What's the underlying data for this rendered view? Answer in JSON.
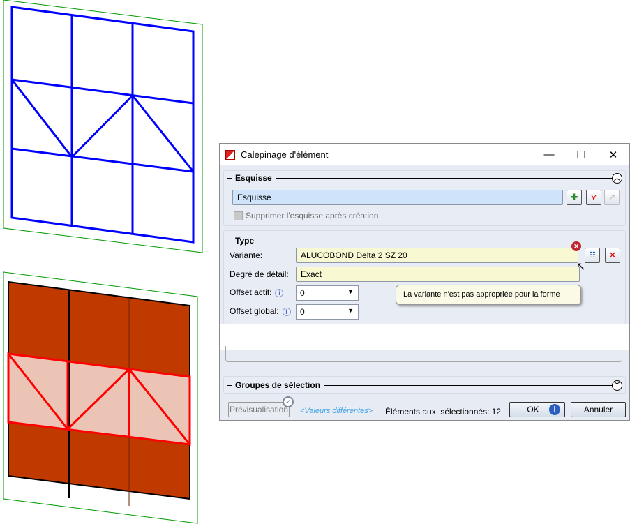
{
  "dialog": {
    "title": "Calepinage d'élément",
    "window_controls": {
      "minimize": "—",
      "maximize": "☐",
      "close": "✕"
    },
    "esquisse": {
      "header": "Esquisse",
      "collapse_icon": "chevron-up",
      "sketch_value": "Esquisse",
      "checkbox_label": "Supprimer l'esquisse après création",
      "checkbox_checked": false
    },
    "type": {
      "header": "Type",
      "variante_label": "Variante:",
      "variante_value": "ALUCOBOND Delta 2 SZ 20",
      "detail_label": "Degré de détail:",
      "detail_value": "Exact",
      "offset_actif_label": "Offset actif:",
      "offset_actif_value": "0",
      "offset_global_label": "Offset global:",
      "offset_global_value": "0",
      "tooltip": "La variante n'est pas appropriée pour la forme"
    },
    "groupes": {
      "header": "Groupes de sélection",
      "expand_icon": "chevron-down"
    },
    "footer": {
      "preview": "Prévisualisation",
      "different_values": "<Valeurs différentes>",
      "selected_count": "Éléments aux. sélectionnés: 12",
      "ok": "OK",
      "cancel": "Annuler"
    }
  },
  "colors": {
    "grid": "#0000ff",
    "frame": "#009900",
    "panel": "#c03a00",
    "highlight": "#ff0000",
    "highlight_fill": "#ecc4b6"
  }
}
